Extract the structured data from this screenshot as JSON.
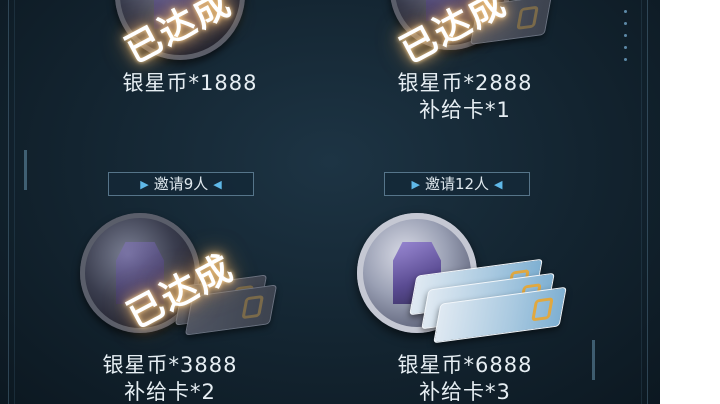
{
  "stamp_text": "已达成",
  "tiers": [
    {
      "reward_lines": [
        "银星币*1888"
      ]
    },
    {
      "reward_lines": [
        "银星币*2888",
        "补给卡*1"
      ]
    },
    {
      "requirement": "邀请9人",
      "reward_lines": [
        "银星币*3888",
        "补给卡*2"
      ]
    },
    {
      "requirement": "邀请12人",
      "reward_lines": [
        "银星币*6888",
        "补给卡*3"
      ]
    }
  ],
  "colors": {
    "glow": "#ffb45a",
    "accent_arrow": "#5fb8e8",
    "panel_bg": "#132430"
  },
  "icons": [
    "silver-star-coin-icon",
    "supply-card-icon",
    "arrow-right-icon",
    "arrow-left-icon"
  ]
}
